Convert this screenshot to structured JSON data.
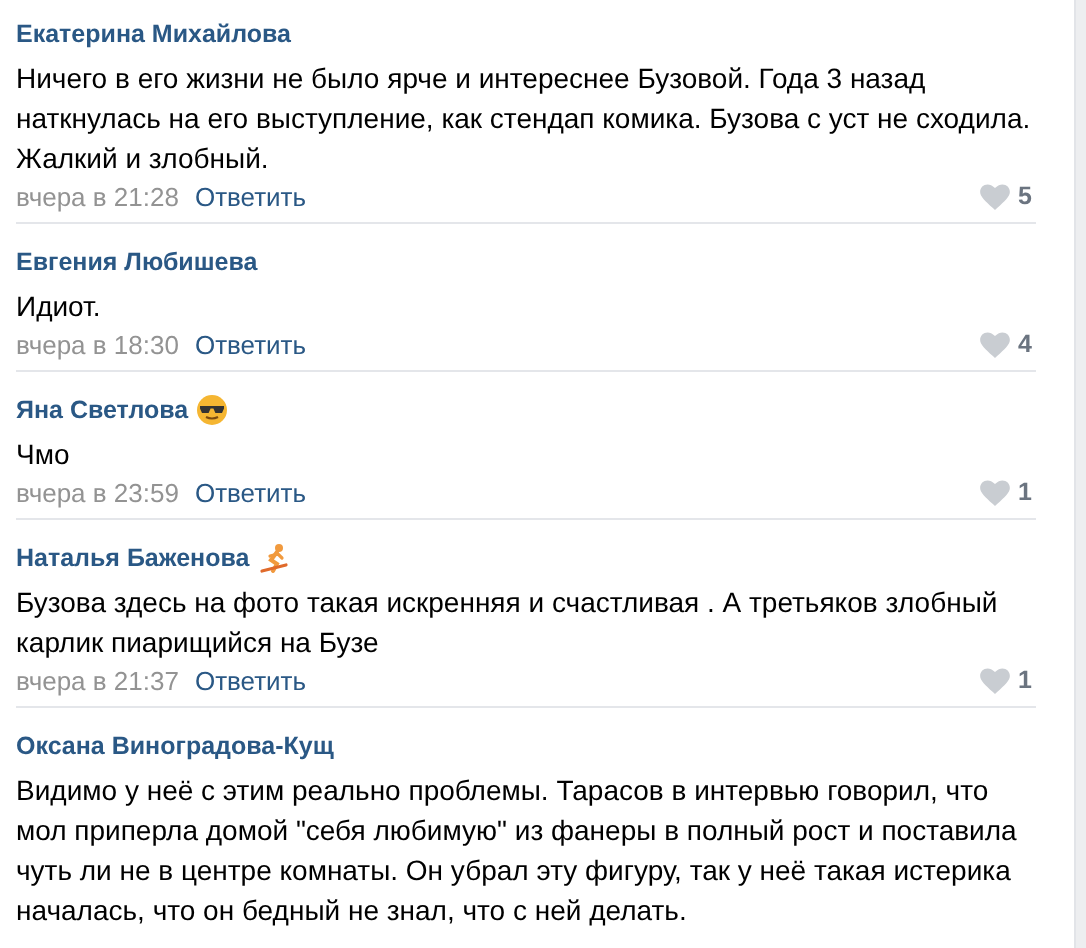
{
  "comments": [
    {
      "author": "Екатерина Михайлова",
      "text": "Ничего в его жизни не было ярче и интереснее Бузовой. Года 3 назад наткнулась на его выступление, как стендап комика. Бузова с уст не сходила. Жалкий и злобный.",
      "time": "вчера в 21:28",
      "reply": "Ответить",
      "likes": "5"
    },
    {
      "author": "Евгения Любишева",
      "text": "Идиот.",
      "time": "вчера в 18:30",
      "reply": "Ответить",
      "likes": "4"
    },
    {
      "author": "Яна Светлова",
      "kind": "sunglasses",
      "text": "Чмо",
      "time": "вчера в 23:59",
      "reply": "Ответить",
      "likes": "1"
    },
    {
      "author": "Наталья Баженова",
      "kind": "figure",
      "text": "Бузова здесь на фото такая искренняя и счастливая . А третьяков злобный карлик пиарищийся на Бузе",
      "time": "вчера в 21:37",
      "reply": "Ответить",
      "likes": "1"
    },
    {
      "author": "Оксана Виноградова-Кущ",
      "text": "Видимо у неё с этим реально проблемы. Тарасов в интервью говорил, что мол приперла домой \"себя любимую\" из фанеры в полный рост и поставила чуть ли не в центре комнаты. Он убрал эту фигуру, так у неё такая истерика началась, что он бедный не знал, что с ней делать."
    }
  ]
}
